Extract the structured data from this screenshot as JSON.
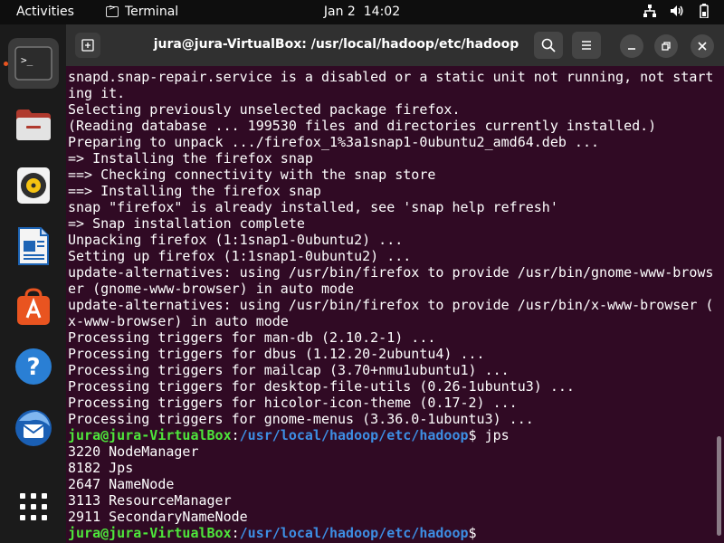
{
  "topbar": {
    "activities": "Activities",
    "app_name": "Terminal",
    "date": "Jan 2",
    "time": "14:02",
    "tray_icons": [
      "network-icon",
      "volume-icon",
      "battery-icon"
    ]
  },
  "dock": {
    "items": [
      {
        "name": "terminal",
        "icon": "terminal-icon",
        "active": true
      },
      {
        "name": "files",
        "icon": "files-icon"
      },
      {
        "name": "rhythmbox",
        "icon": "rhythmbox-icon"
      },
      {
        "name": "libreoffice-writer",
        "icon": "writer-icon"
      },
      {
        "name": "software",
        "icon": "software-icon"
      },
      {
        "name": "help",
        "icon": "help-icon"
      },
      {
        "name": "thunderbird",
        "icon": "thunderbird-icon"
      },
      {
        "name": "show-applications",
        "icon": "app-grid-icon"
      }
    ],
    "accent": "#e95420"
  },
  "window": {
    "title": "jura@jura-VirtualBox: /usr/local/hadoop/etc/hadoop",
    "background": "#300a24"
  },
  "terminal": {
    "output_lines": [
      "snapd.snap-repair.service is a disabled or a static unit not running, not start",
      "ing it.",
      "Selecting previously unselected package firefox.",
      "(Reading database ... 199530 files and directories currently installed.)",
      "Preparing to unpack .../firefox_1%3a1snap1-0ubuntu2_amd64.deb ...",
      "=> Installing the firefox snap",
      "==> Checking connectivity with the snap store",
      "==> Installing the firefox snap",
      "snap \"firefox\" is already installed, see 'snap help refresh'",
      "=> Snap installation complete",
      "Unpacking firefox (1:1snap1-0ubuntu2) ...",
      "Setting up firefox (1:1snap1-0ubuntu2) ...",
      "update-alternatives: using /usr/bin/firefox to provide /usr/bin/gnome-www-brows",
      "er (gnome-www-browser) in auto mode",
      "update-alternatives: using /usr/bin/firefox to provide /usr/bin/x-www-browser (",
      "x-www-browser) in auto mode",
      "Processing triggers for man-db (2.10.2-1) ...",
      "Processing triggers for dbus (1.12.20-2ubuntu4) ...",
      "Processing triggers for mailcap (3.70+nmu1ubuntu1) ...",
      "Processing triggers for desktop-file-utils (0.26-1ubuntu3) ...",
      "Processing triggers for hicolor-icon-theme (0.17-2) ...",
      "Processing triggers for gnome-menus (3.36.0-1ubuntu3) ..."
    ],
    "prompt": {
      "user_host": "jura@jura-VirtualBox",
      "colon": ":",
      "path": "/usr/local/hadoop/etc/hadoop",
      "dollar": "$"
    },
    "command": " jps",
    "jps_output": [
      "3220 NodeManager",
      "8182 Jps",
      "2647 NameNode",
      "3113 ResourceManager",
      "2911 SecondaryNameNode"
    ],
    "final_input": ""
  }
}
